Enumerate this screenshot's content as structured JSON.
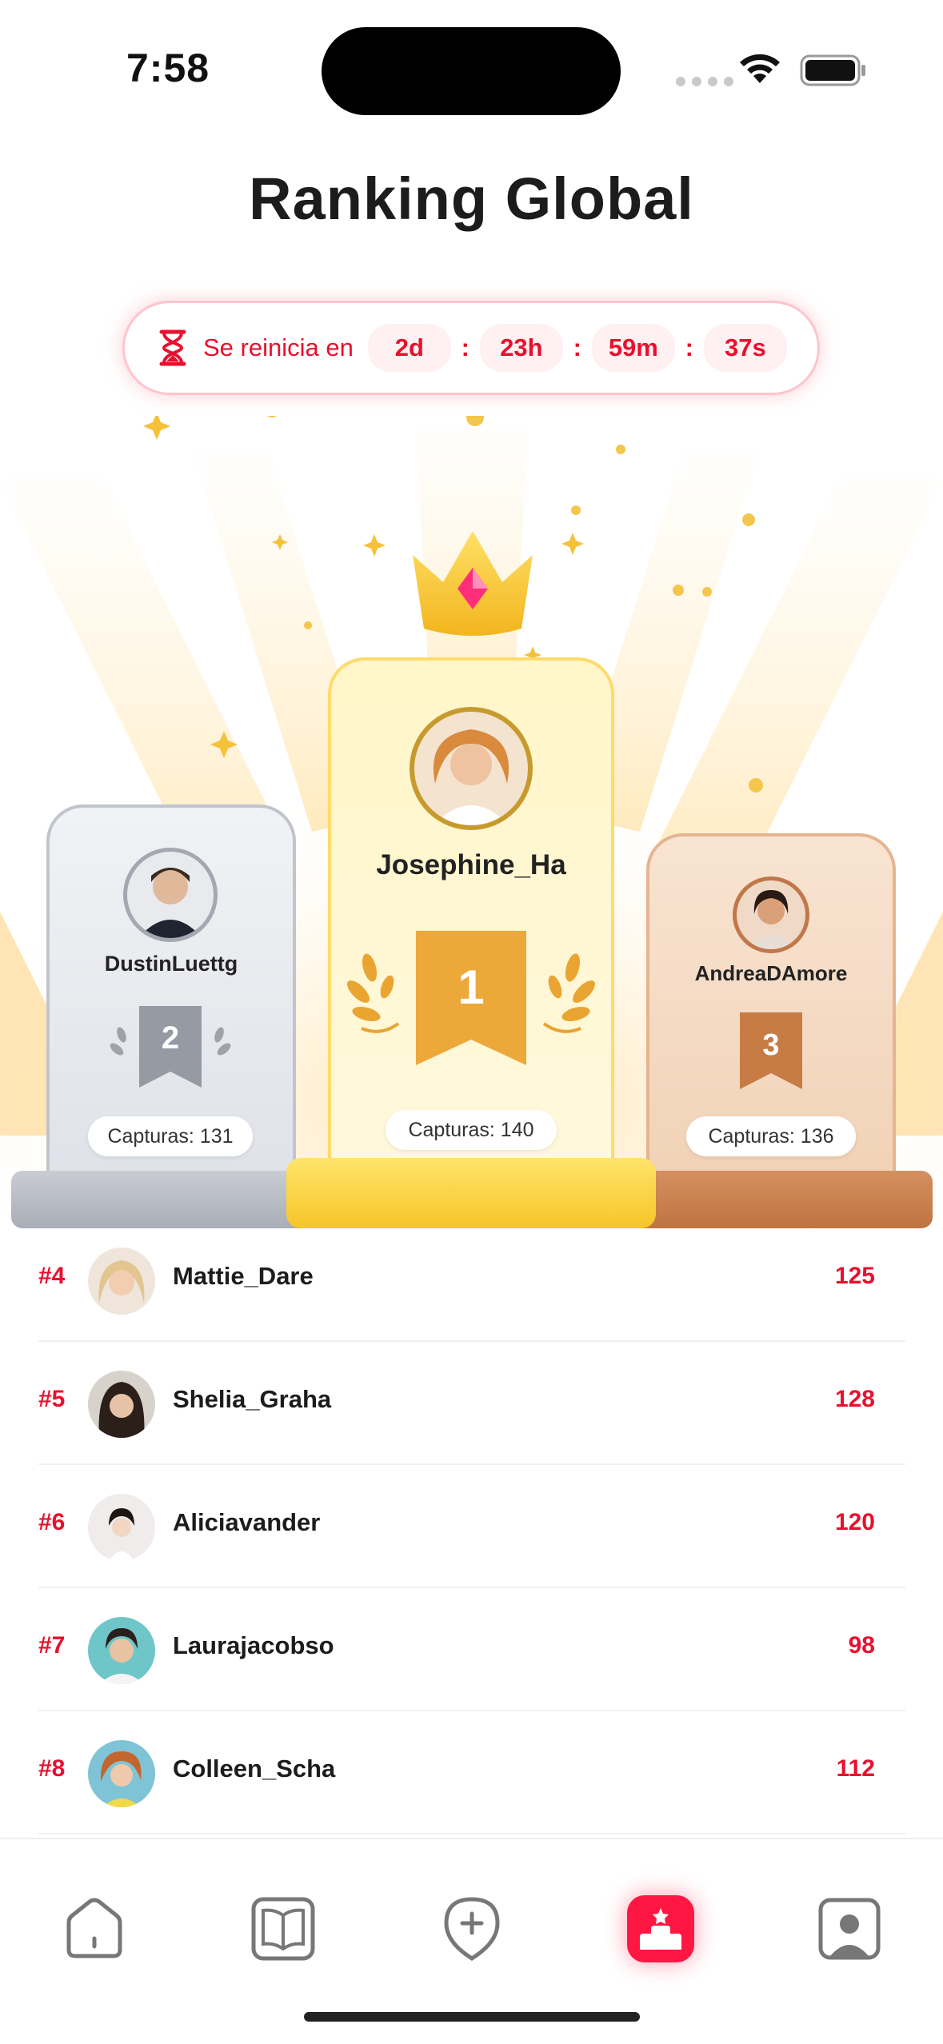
{
  "status_bar": {
    "time": "7:58"
  },
  "header": {
    "title": "Ranking Global"
  },
  "timer": {
    "label": "Se reinicia en",
    "days": "2d",
    "hours": "23h",
    "minutes": "59m",
    "seconds": "37s",
    "separator": ":"
  },
  "podium": {
    "first": {
      "rank": "1",
      "name": "Josephine_Ha",
      "captures": "Capturas: 140"
    },
    "second": {
      "rank": "2",
      "name": "DustinLuettg",
      "captures": "Capturas: 131"
    },
    "third": {
      "rank": "3",
      "name": "AndreaDAmore",
      "captures": "Capturas: 136"
    }
  },
  "leaderboard": [
    {
      "rank": "#4",
      "name": "Mattie_Dare",
      "score": "125"
    },
    {
      "rank": "#5",
      "name": "Shelia_Graha",
      "score": "128"
    },
    {
      "rank": "#6",
      "name": "Aliciavander",
      "score": "120"
    },
    {
      "rank": "#7",
      "name": "Laurajacobso",
      "score": "98"
    },
    {
      "rank": "#8",
      "name": "Colleen_Scha",
      "score": "112"
    }
  ],
  "tab_bar": {
    "tabs": [
      {
        "icon": "home-icon"
      },
      {
        "icon": "book-icon"
      },
      {
        "icon": "add-location-icon"
      },
      {
        "icon": "podium-icon",
        "active": true
      },
      {
        "icon": "profile-icon"
      }
    ]
  },
  "colors": {
    "accent": "#e8102e",
    "gold": "#ffd84a",
    "silver": "#c9ccd3",
    "bronze": "#c77b45"
  }
}
